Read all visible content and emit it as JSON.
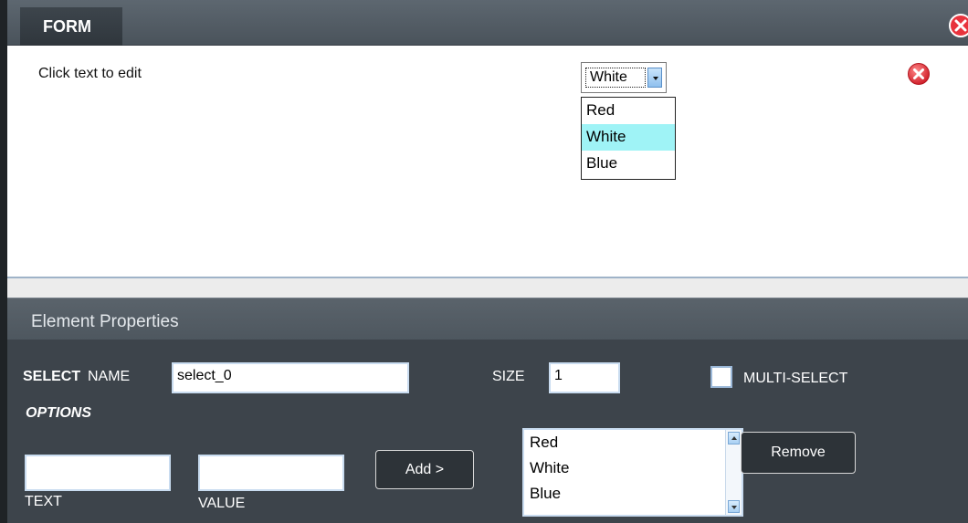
{
  "window": {
    "tab_label": "FORM"
  },
  "form_area": {
    "hint": "Click text to edit",
    "select_value": "White",
    "dropdown_options": [
      "Red",
      "White",
      "Blue"
    ],
    "dropdown_selected": "White"
  },
  "properties": {
    "title": "Element Properties",
    "select_label": "SELECT",
    "name_label": "NAME",
    "name_value": "select_0",
    "size_label": "SIZE",
    "size_value": "1",
    "multiselect_label": "MULTI-SELECT",
    "multiselect_checked": false,
    "options_label": "OPTIONS",
    "text_label": "TEXT",
    "value_label": "VALUE",
    "text_value": "",
    "value_value": "",
    "add_label": "Add >",
    "remove_label": "Remove",
    "option_list": [
      "Red",
      "White",
      "Blue"
    ]
  },
  "colors": {
    "accent_delete": "#e8333d",
    "selected_option_bg": "#9ff3f6",
    "panel_bg": "#3d444b"
  }
}
